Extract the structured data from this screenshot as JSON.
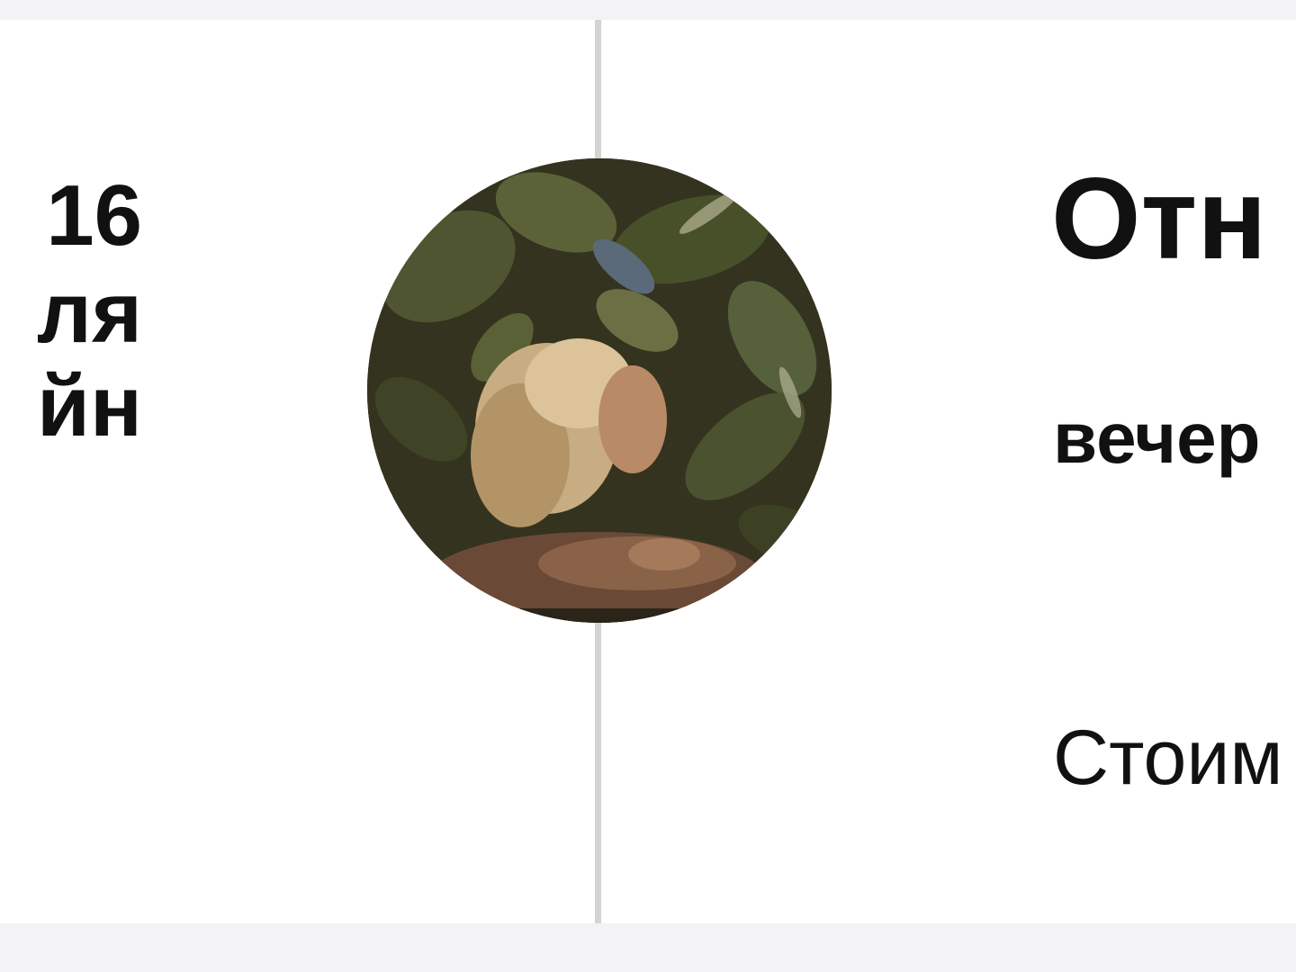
{
  "left": {
    "lines": [
      "16",
      "ля",
      "йн"
    ]
  },
  "right": {
    "title": "Отн",
    "subtitle": "вечер",
    "price_label": "Стоим"
  },
  "avatar": {
    "icon": "event-photo-avatar"
  },
  "colors": {
    "background": "#f3f3f6",
    "card": "#ffffff",
    "timeline": "#d4d4d4",
    "text": "#111111"
  }
}
